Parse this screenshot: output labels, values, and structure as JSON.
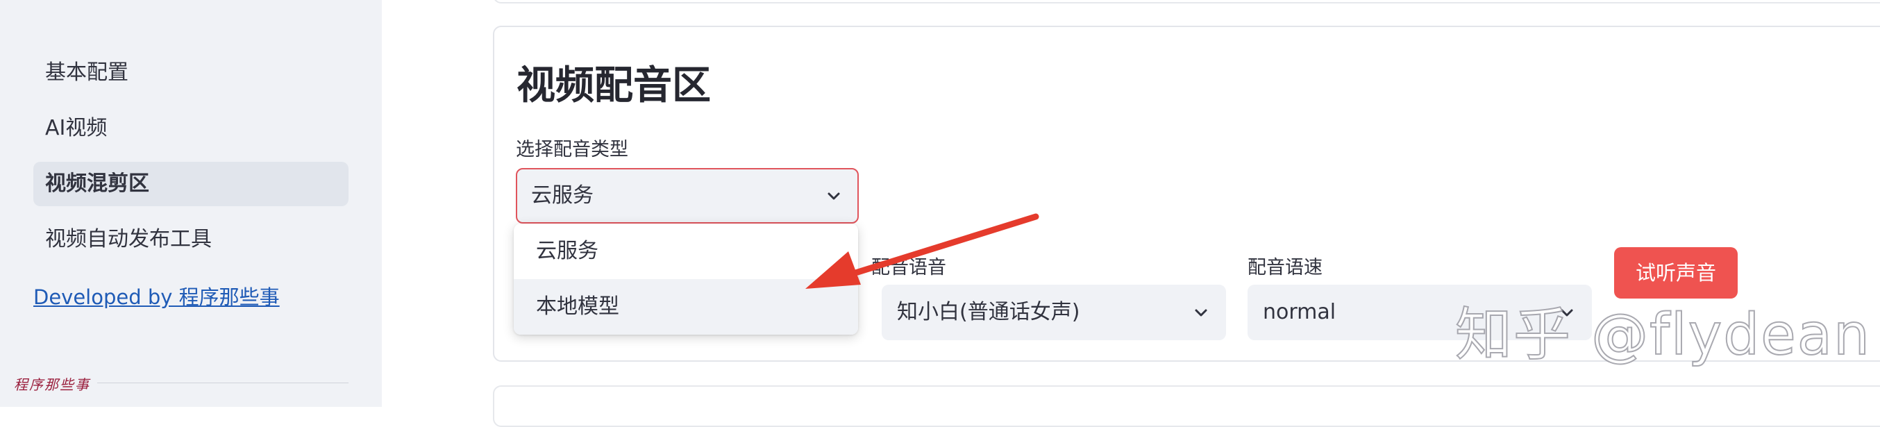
{
  "sidebar": {
    "items": [
      {
        "label": "基本配置"
      },
      {
        "label": "AI视频"
      },
      {
        "label": "视频混剪区"
      },
      {
        "label": "视频自动发布工具"
      }
    ],
    "link": "Developed by 程序那些事",
    "signature": "程序那些事"
  },
  "main": {
    "section_title": "视频配音区",
    "voice_type": {
      "label": "选择配音类型",
      "value": "云服务",
      "options": [
        "云服务",
        "本地模型"
      ]
    },
    "voice": {
      "label": "配音语音",
      "value": "知小白(普通话女声)"
    },
    "speed": {
      "label": "配音语速",
      "value": "normal"
    },
    "preview_button": "试听声音"
  },
  "watermark": "知乎 @flydean",
  "colors": {
    "accent": "#ef5350",
    "focus_border": "#e0545c",
    "annotation_arrow": "#e53b2c",
    "link": "#1f5bb6",
    "sidebar_bg": "#f0f2f6"
  },
  "icons": {
    "select_chevron": "chevron-down-icon",
    "annotation": "red-arrow-annotation"
  }
}
